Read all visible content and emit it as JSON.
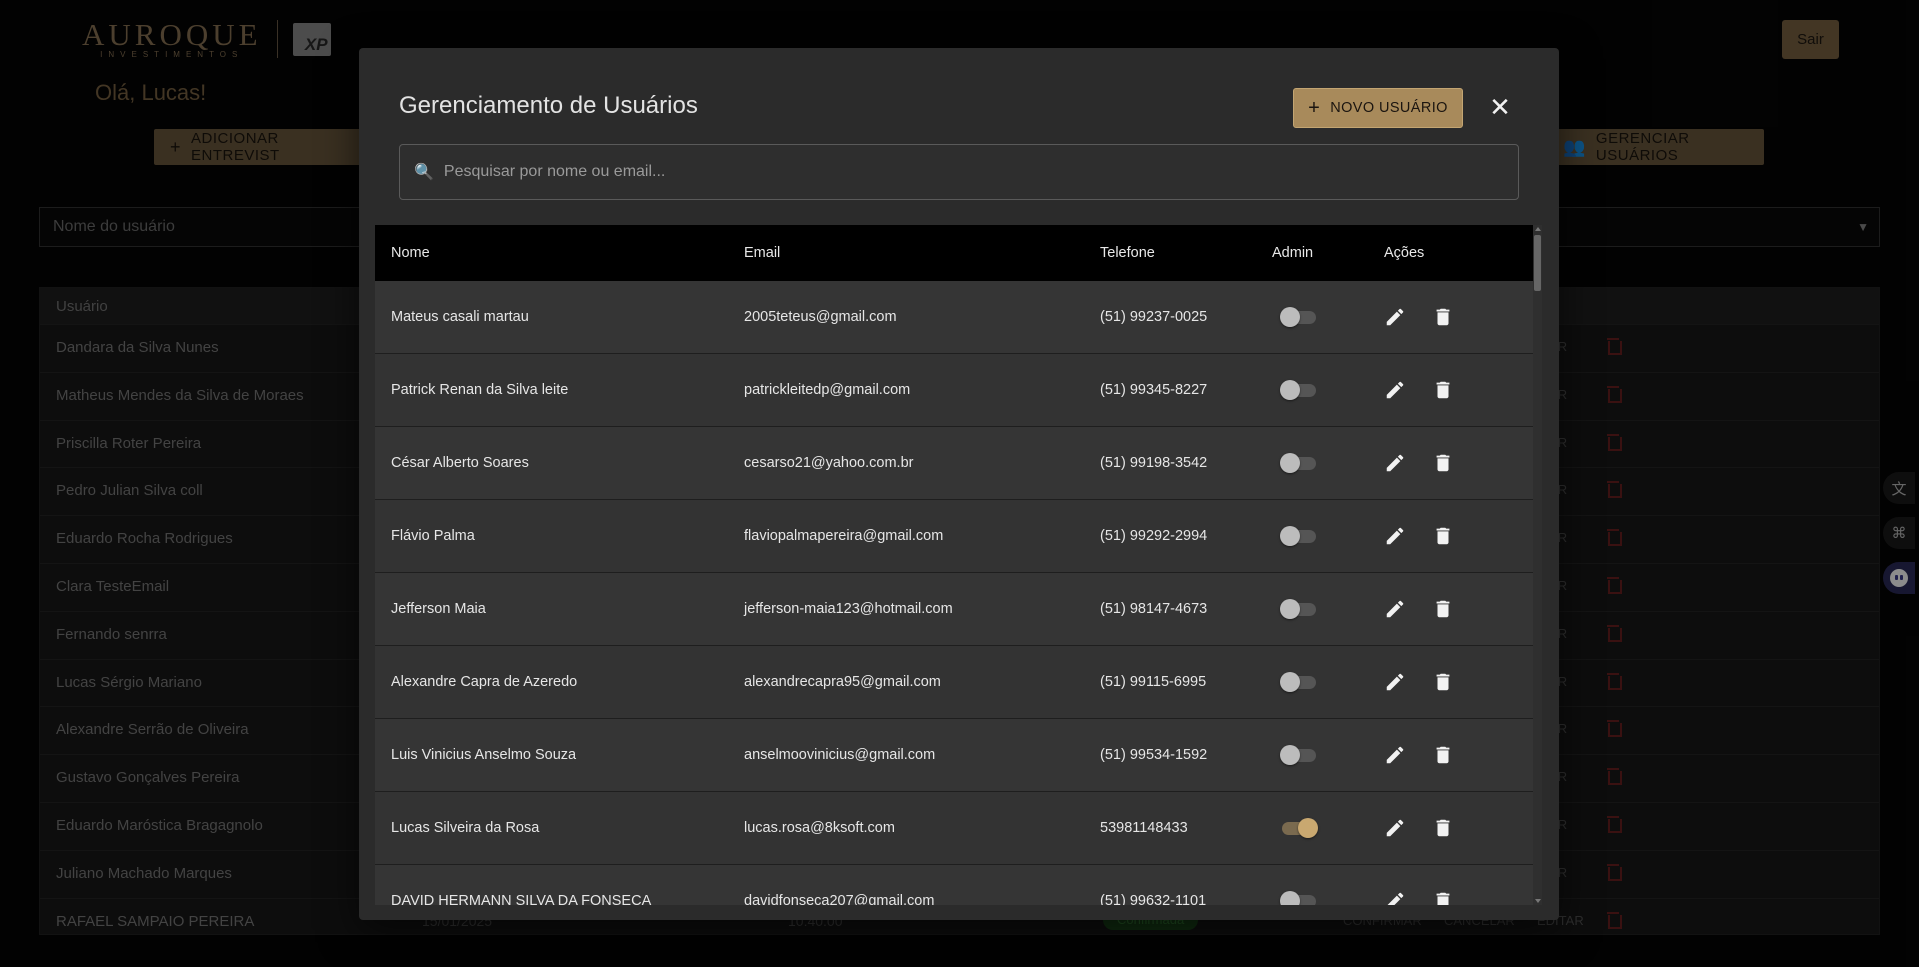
{
  "brand": {
    "logo_main": "AUROQUE",
    "logo_sub": "INVESTIMENTOS",
    "logo_badge": "XP"
  },
  "header": {
    "logout_label": "Sair",
    "greeting": "Olá, Lucas!"
  },
  "actions": {
    "add_interview_label": "ADICIONAR ENTREVIST",
    "manage_users_label": "GERENCIAR USUÁRIOS"
  },
  "filters": {
    "user_name_placeholder": "Nome do usuário"
  },
  "background_table": {
    "header": "Usuário",
    "edit_label": "ITAR",
    "rows": [
      "Dandara da Silva Nunes",
      "Matheus Mendes da Silva de Moraes",
      "Priscilla Roter Pereira",
      "Pedro Julian Silva coll",
      "Eduardo Rocha Rodrigues",
      "Clara TesteEmail",
      "Fernando senrra",
      "Lucas Sérgio Mariano",
      "Alexandre Serrão de Oliveira",
      "Gustavo Gonçalves Pereira",
      "Eduardo Maróstica Bragagnolo",
      "Juliano Machado Marques"
    ],
    "last_row": {
      "name": "RAFAEL SAMPAIO PEREIRA",
      "date": "15/01/2025",
      "time": "10:40:00",
      "status": "Confirmada",
      "confirm": "CONFIRMAR",
      "cancel": "CANCELAR",
      "edit": "EDITAR"
    }
  },
  "modal": {
    "title": "Gerenciamento de Usuários",
    "new_user_label": "NOVO USUÁRIO",
    "search_placeholder": "Pesquisar por nome ou email...",
    "columns": {
      "name": "Nome",
      "email": "Email",
      "phone": "Telefone",
      "admin": "Admin",
      "actions": "Ações"
    },
    "users": [
      {
        "name": "Mateus casali martau",
        "email": "2005teteus@gmail.com",
        "phone": "(51) 99237-0025",
        "admin": false
      },
      {
        "name": "Patrick Renan da Silva leite",
        "email": "patrickleitedp@gmail.com",
        "phone": "(51) 99345-8227",
        "admin": false
      },
      {
        "name": "César Alberto Soares",
        "email": "cesarso21@yahoo.com.br",
        "phone": "(51) 99198-3542",
        "admin": false
      },
      {
        "name": "Flávio Palma",
        "email": "flaviopalmapereira@gmail.com",
        "phone": "(51) 99292-2994",
        "admin": false
      },
      {
        "name": "Jefferson Maia",
        "email": "jefferson-maia123@hotmail.com",
        "phone": "(51) 98147-4673",
        "admin": false
      },
      {
        "name": "Alexandre Capra de Azeredo",
        "email": "alexandrecapra95@gmail.com",
        "phone": "(51) 99115-6995",
        "admin": false
      },
      {
        "name": "Luis Vinicius Anselmo Souza",
        "email": "anselmoovinicius@gmail.com",
        "phone": "(51) 99534-1592",
        "admin": false
      },
      {
        "name": "Lucas Silveira da Rosa",
        "email": "lucas.rosa@8ksoft.com",
        "phone": "53981148433",
        "admin": true
      },
      {
        "name": "DAVID HERMANN SILVA DA FONSECA",
        "email": "davidfonseca207@gmail.com",
        "phone": "(51) 99632-1101",
        "admin": false
      }
    ]
  },
  "colors": {
    "accent": "#a88a5b",
    "accent_dark": "#7a6343",
    "modal_bg": "#2b2b2b",
    "danger": "#6b1f1f"
  }
}
